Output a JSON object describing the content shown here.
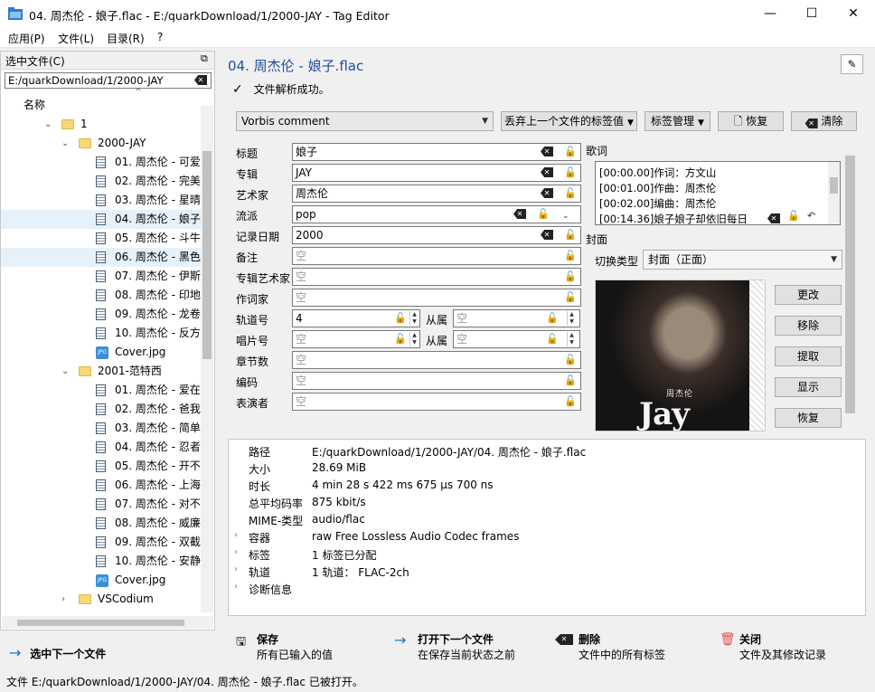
{
  "window": {
    "title": "04. 周杰伦 - 娘子.flac - E:/quarkDownload/1/2000-JAY - Tag Editor",
    "minimize": "—",
    "maximize": "☐",
    "close": "✕"
  },
  "menu": [
    "应用(P)",
    "文件(L)",
    "目录(R)",
    "?"
  ],
  "left_panel": {
    "header": "选中文件(C)",
    "path": "E:/quarkDownload/1/2000-JAY",
    "column": "名称",
    "tree": [
      {
        "label": "1",
        "kind": "folder",
        "expanded": true
      },
      {
        "label": "2000-JAY",
        "kind": "folder",
        "expanded": true
      },
      {
        "label": "01. 周杰伦 - 可爱",
        "kind": "file"
      },
      {
        "label": "02. 周杰伦 - 完美",
        "kind": "file"
      },
      {
        "label": "03. 周杰伦 - 星晴",
        "kind": "file"
      },
      {
        "label": "04. 周杰伦 - 娘子",
        "kind": "file",
        "selected": true
      },
      {
        "label": "05. 周杰伦 - 斗牛",
        "kind": "file"
      },
      {
        "label": "06. 周杰伦 - 黑色",
        "kind": "file",
        "selected": true
      },
      {
        "label": "07. 周杰伦 - 伊斯",
        "kind": "file"
      },
      {
        "label": "08. 周杰伦 - 印地",
        "kind": "file"
      },
      {
        "label": "09. 周杰伦 - 龙卷",
        "kind": "file"
      },
      {
        "label": "10. 周杰伦 - 反方",
        "kind": "file"
      },
      {
        "label": "Cover.jpg",
        "kind": "jpg"
      },
      {
        "label": "2001-范特西",
        "kind": "folder",
        "expanded": true
      },
      {
        "label": "01. 周杰伦 - 爱在",
        "kind": "file"
      },
      {
        "label": "02. 周杰伦 - 爸我",
        "kind": "file"
      },
      {
        "label": "03. 周杰伦 - 简单",
        "kind": "file"
      },
      {
        "label": "04. 周杰伦 - 忍者",
        "kind": "file"
      },
      {
        "label": "05. 周杰伦 - 开不",
        "kind": "file"
      },
      {
        "label": "06. 周杰伦 - 上海",
        "kind": "file"
      },
      {
        "label": "07. 周杰伦 - 对不",
        "kind": "file"
      },
      {
        "label": "08. 周杰伦 - 威廉",
        "kind": "file"
      },
      {
        "label": "09. 周杰伦 - 双截",
        "kind": "file"
      },
      {
        "label": "10. 周杰伦 - 安静",
        "kind": "file"
      },
      {
        "label": "Cover.jpg",
        "kind": "jpg"
      },
      {
        "label": "VSCodium",
        "kind": "folder",
        "expanded": false
      }
    ]
  },
  "editor": {
    "file_title": "04. 周杰伦 - 娘子.flac",
    "status": "文件解析成功。",
    "tag_format": "Vorbis comment",
    "discard_button": "丢弃上一个文件的标签值",
    "tag_manage_button": "标签管理",
    "restore_button": "恢复",
    "clear_button": "清除",
    "fields": [
      {
        "label": "标题",
        "value": "娘子"
      },
      {
        "label": "专辑",
        "value": "JAY"
      },
      {
        "label": "艺术家",
        "value": "周杰伦"
      },
      {
        "label": "流派",
        "value": "pop"
      },
      {
        "label": "记录日期",
        "value": "2000"
      },
      {
        "label": "备注",
        "value": "空"
      },
      {
        "label": "专辑艺术家",
        "value": "空"
      },
      {
        "label": "作词家",
        "value": "空"
      },
      {
        "label": "轨道号",
        "value": "4",
        "of_label": "从属",
        "of_value": "空"
      },
      {
        "label": "唱片号",
        "value": "空",
        "of_label": "从属",
        "of_value": "空"
      },
      {
        "label": "章节数",
        "value": "空"
      },
      {
        "label": "编码",
        "value": "空"
      },
      {
        "label": "表演者",
        "value": "空"
      }
    ],
    "lyrics_label": "歌词",
    "lyrics": [
      "[00:00.00]作词：方文山",
      "[00:01.00]作曲：周杰伦",
      "[00:02.00]编曲：周杰伦",
      "[00:14.36]娘子娘子却依旧每日"
    ],
    "cover_label": "封面",
    "cover_switch_label": "切换类型",
    "cover_type": "封面（正面）",
    "cover_text_small": "周杰伦",
    "cover_text_big": "Jay",
    "cover_buttons": [
      "更改",
      "移除",
      "提取",
      "显示",
      "恢复"
    ]
  },
  "info": [
    {
      "key": "路径",
      "value": "E:/quarkDownload/1/2000-JAY/04. 周杰伦 - 娘子.flac"
    },
    {
      "key": "大小",
      "value": "28.69 MiB"
    },
    {
      "key": "时长",
      "value": "4 min 28 s 422 ms 675 µs 700 ns"
    },
    {
      "key": "总平均码率",
      "value": "875 kbit/s"
    },
    {
      "key": "MIME-类型",
      "value": "audio/flac"
    },
    {
      "key": "容器",
      "value": "raw Free Lossless Audio Codec frames",
      "expandable": true
    },
    {
      "key": "标签",
      "value": "1 标签已分配",
      "expandable": true
    },
    {
      "key": "轨道",
      "value": "1 轨道： FLAC-2ch",
      "expandable": true
    },
    {
      "key": "诊断信息",
      "value": "",
      "expandable": true
    }
  ],
  "actions": {
    "next_select": "选中下一个文件",
    "save_title": "保存",
    "save_sub": "所有已输入的值",
    "open_next_title": "打开下一个文件",
    "open_next_sub": "在保存当前状态之前",
    "delete_title": "删除",
    "delete_sub": "文件中的所有标签",
    "close_title": "关闭",
    "close_sub": "文件及其修改记录"
  },
  "statusbar": "文件 E:/quarkDownload/1/2000-JAY/04. 周杰伦 - 娘子.flac 已被打开。",
  "colors": {
    "accent": "#1f4fa0",
    "selection": "#e5f1fb",
    "arrow_blue": "#1a73c8",
    "close_red": "#d9534f"
  }
}
